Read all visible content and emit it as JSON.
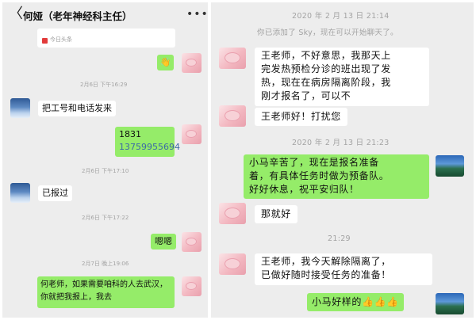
{
  "left_chat": {
    "back_glyph": "〈",
    "title": "何娅（老年神经科主任）",
    "more_glyph": "•••",
    "card_source": "今日头条",
    "sent_emoji": "👋",
    "ts1": "2月6日 下午16:29",
    "msg1": "把工号和电话发来",
    "msg2_line1": "1831",
    "msg2_line2": "13759955694",
    "ts2": "2月6日 下午17:10",
    "msg3": "已报过",
    "ts3": "2月6日 下午17:22",
    "msg4": "嗯嗯",
    "ts4": "2月7日 晚上19:06",
    "msg5_line1": "何老师，如果需要咱科的人去武汉，",
    "msg5_line2": "你就把我报上，我去"
  },
  "right_chat": {
    "ts1": "2020 年 2 月 13 日 21:14",
    "system_msg": "你已添加了 Sky，现在可以开始聊天了。",
    "msg1_lines": [
      "王老师，不好意思，我那天上",
      "完发热预检分诊的班出现了发",
      "热，现在在病房隔离阶段，我",
      "刚才报名了，可以不"
    ],
    "msg2": "王老师好！打扰您",
    "ts2": "2020 年 2 月 13 日 21:23",
    "msg3_lines": [
      "小马辛苦了，现在是报名准备",
      "着，有具体任务时做为预备队。",
      "好好休息，祝平安归队！"
    ],
    "msg4": "那就好",
    "ts3": "21:29",
    "msg5_lines": [
      "王老师，我今天解除隔离了，",
      "已做好随时接受任务的准备！"
    ],
    "msg6_text": "小马好样的",
    "msg6_emoji": "👍👍👍"
  }
}
